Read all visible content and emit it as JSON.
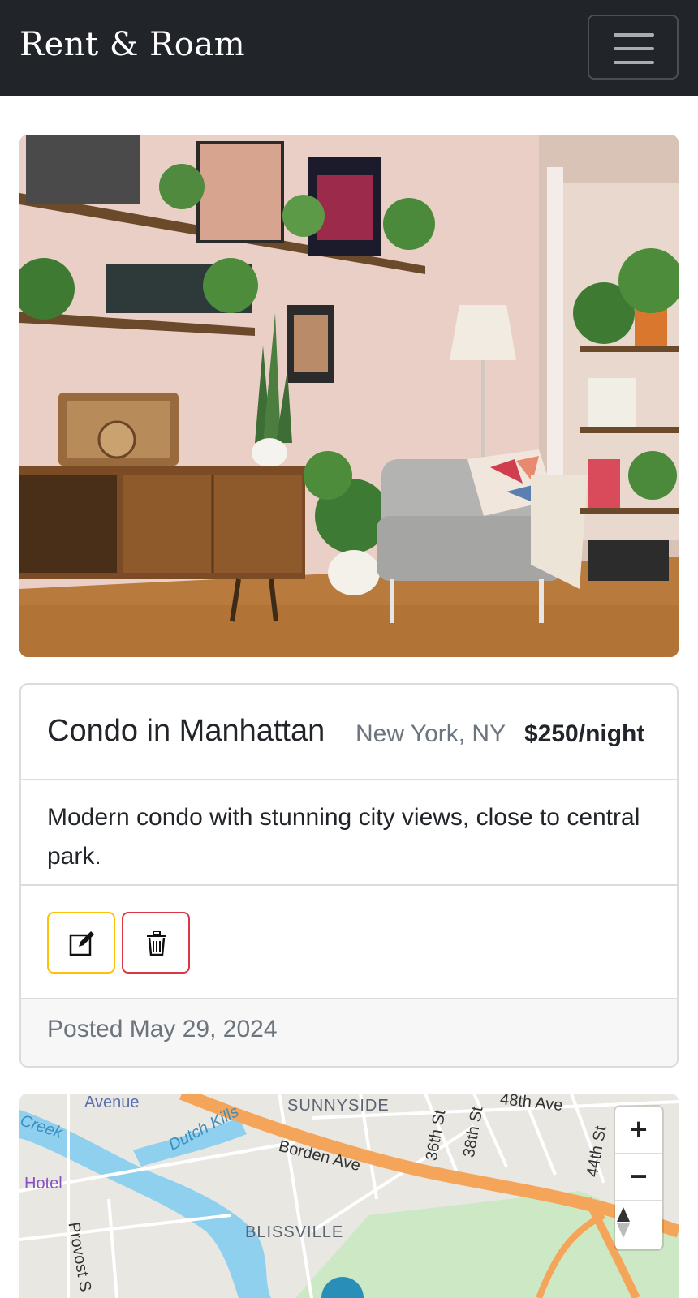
{
  "app": {
    "brand": "Rent & Roam"
  },
  "navbar": {
    "menu_icon": "hamburger-icon"
  },
  "listing": {
    "title": "Condo in Manhattan",
    "location": "New York, NY",
    "price": "$250/night",
    "description": "Modern condo with stunning city views, close to central park.",
    "posted": "Posted May 29, 2024",
    "actions": {
      "edit_icon": "edit-icon",
      "delete_icon": "trash-icon"
    },
    "colors": {
      "edit": "#ffc107",
      "delete": "#dc3545"
    }
  },
  "map": {
    "labels": {
      "avenue": "Avenue",
      "sunnyside": "SUNNYSIDE",
      "creek": "Creek",
      "dutch_kills": "Dutch Kills",
      "hotel": "Hotel",
      "borden_ave": "Borden Ave",
      "st36": "36th St",
      "st38": "38th St",
      "ave48": "48th Ave",
      "st44": "44th St",
      "blissville": "BLISSVILLE",
      "provost": "Provost S"
    },
    "controls": {
      "zoom_in": "+",
      "zoom_out": "−",
      "compass_icon": "compass-icon"
    }
  }
}
